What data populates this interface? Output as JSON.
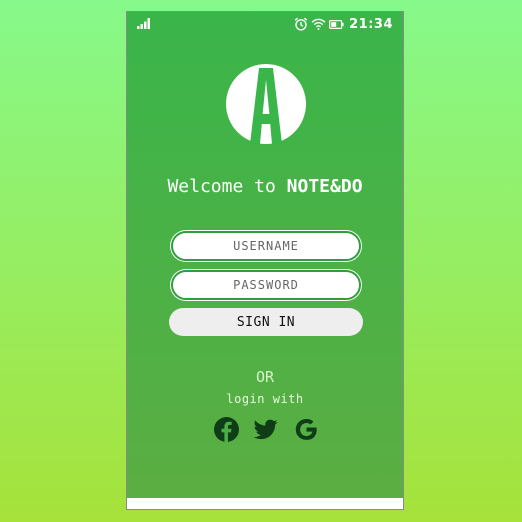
{
  "status_bar": {
    "time": "21:34",
    "icons": [
      "signal-icon",
      "alarm-icon",
      "wifi-icon",
      "battery-icon"
    ]
  },
  "logo": {
    "letter": "A"
  },
  "welcome": {
    "prefix": "Welcome to ",
    "brand": "NOTE&DO"
  },
  "form": {
    "username_placeholder": "USERNAME",
    "password_placeholder": "PASSWORD",
    "signin_label": "SIGN IN"
  },
  "alt_login": {
    "or_label": "OR",
    "login_with_label": "login with",
    "providers": [
      "facebook-icon",
      "twitter-icon",
      "google-icon"
    ]
  },
  "colors": {
    "background_top": "#86f98a",
    "background_bottom": "#a6e23a",
    "screen_top": "#3ab54a",
    "screen_bottom": "#5bae42",
    "field_border": "#2e9e3e",
    "social_icon": "#0f3d18",
    "button_bg": "#eeeeee"
  }
}
